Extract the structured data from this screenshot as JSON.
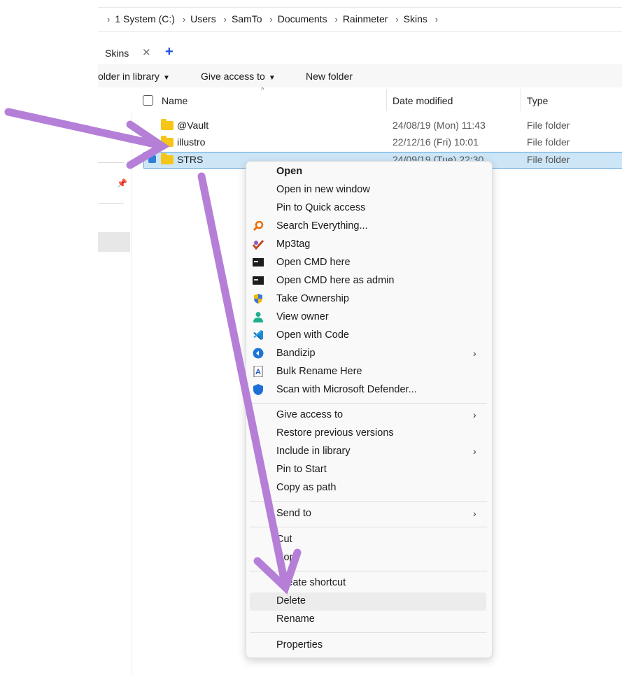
{
  "breadcrumb": [
    "1 System (C:)",
    "Users",
    "SamTo",
    "Documents",
    "Rainmeter",
    "Skins"
  ],
  "tab": {
    "label": "Skins",
    "close": "✕",
    "new": "+"
  },
  "commands": {
    "library": "older in library",
    "give_access": "Give access to",
    "new_folder": "New folder"
  },
  "columns": {
    "name": "Name",
    "date": "Date modified",
    "type": "Type"
  },
  "files": [
    {
      "name": "@Vault",
      "date": "24/08/19 (Mon) 11:43",
      "type": "File folder"
    },
    {
      "name": "illustro",
      "date": "22/12/16 (Fri) 10:01",
      "type": "File folder"
    },
    {
      "name": "STRS",
      "date": "24/09/19 (Tue) 22:30",
      "type": "File folder"
    }
  ],
  "pin_icon": "pin-icon",
  "menu": {
    "open": "Open",
    "open_new_window": "Open in new window",
    "pin_quick": "Pin to Quick access",
    "search_everything": "Search Everything...",
    "mp3tag": "Mp3tag",
    "open_cmd": "Open CMD here",
    "open_cmd_admin": "Open CMD here as admin",
    "take_ownership": "Take Ownership",
    "view_owner": "View owner",
    "open_code": "Open with Code",
    "bandizip": "Bandizip",
    "bulk_rename": "Bulk Rename Here",
    "scan_defender": "Scan with Microsoft Defender...",
    "give_access": "Give access to",
    "restore_versions": "Restore previous versions",
    "include_library": "Include in library",
    "pin_start": "Pin to Start",
    "copy_path": "Copy as path",
    "send_to": "Send to",
    "cut": "Cut",
    "copy": "Copy",
    "create_shortcut": "Create shortcut",
    "delete": "Delete",
    "rename": "Rename",
    "properties": "Properties"
  },
  "colors": {
    "annotation_arrow": "#b57fd8",
    "selection": "#cde6f7",
    "accent": "#1f4fe0"
  }
}
